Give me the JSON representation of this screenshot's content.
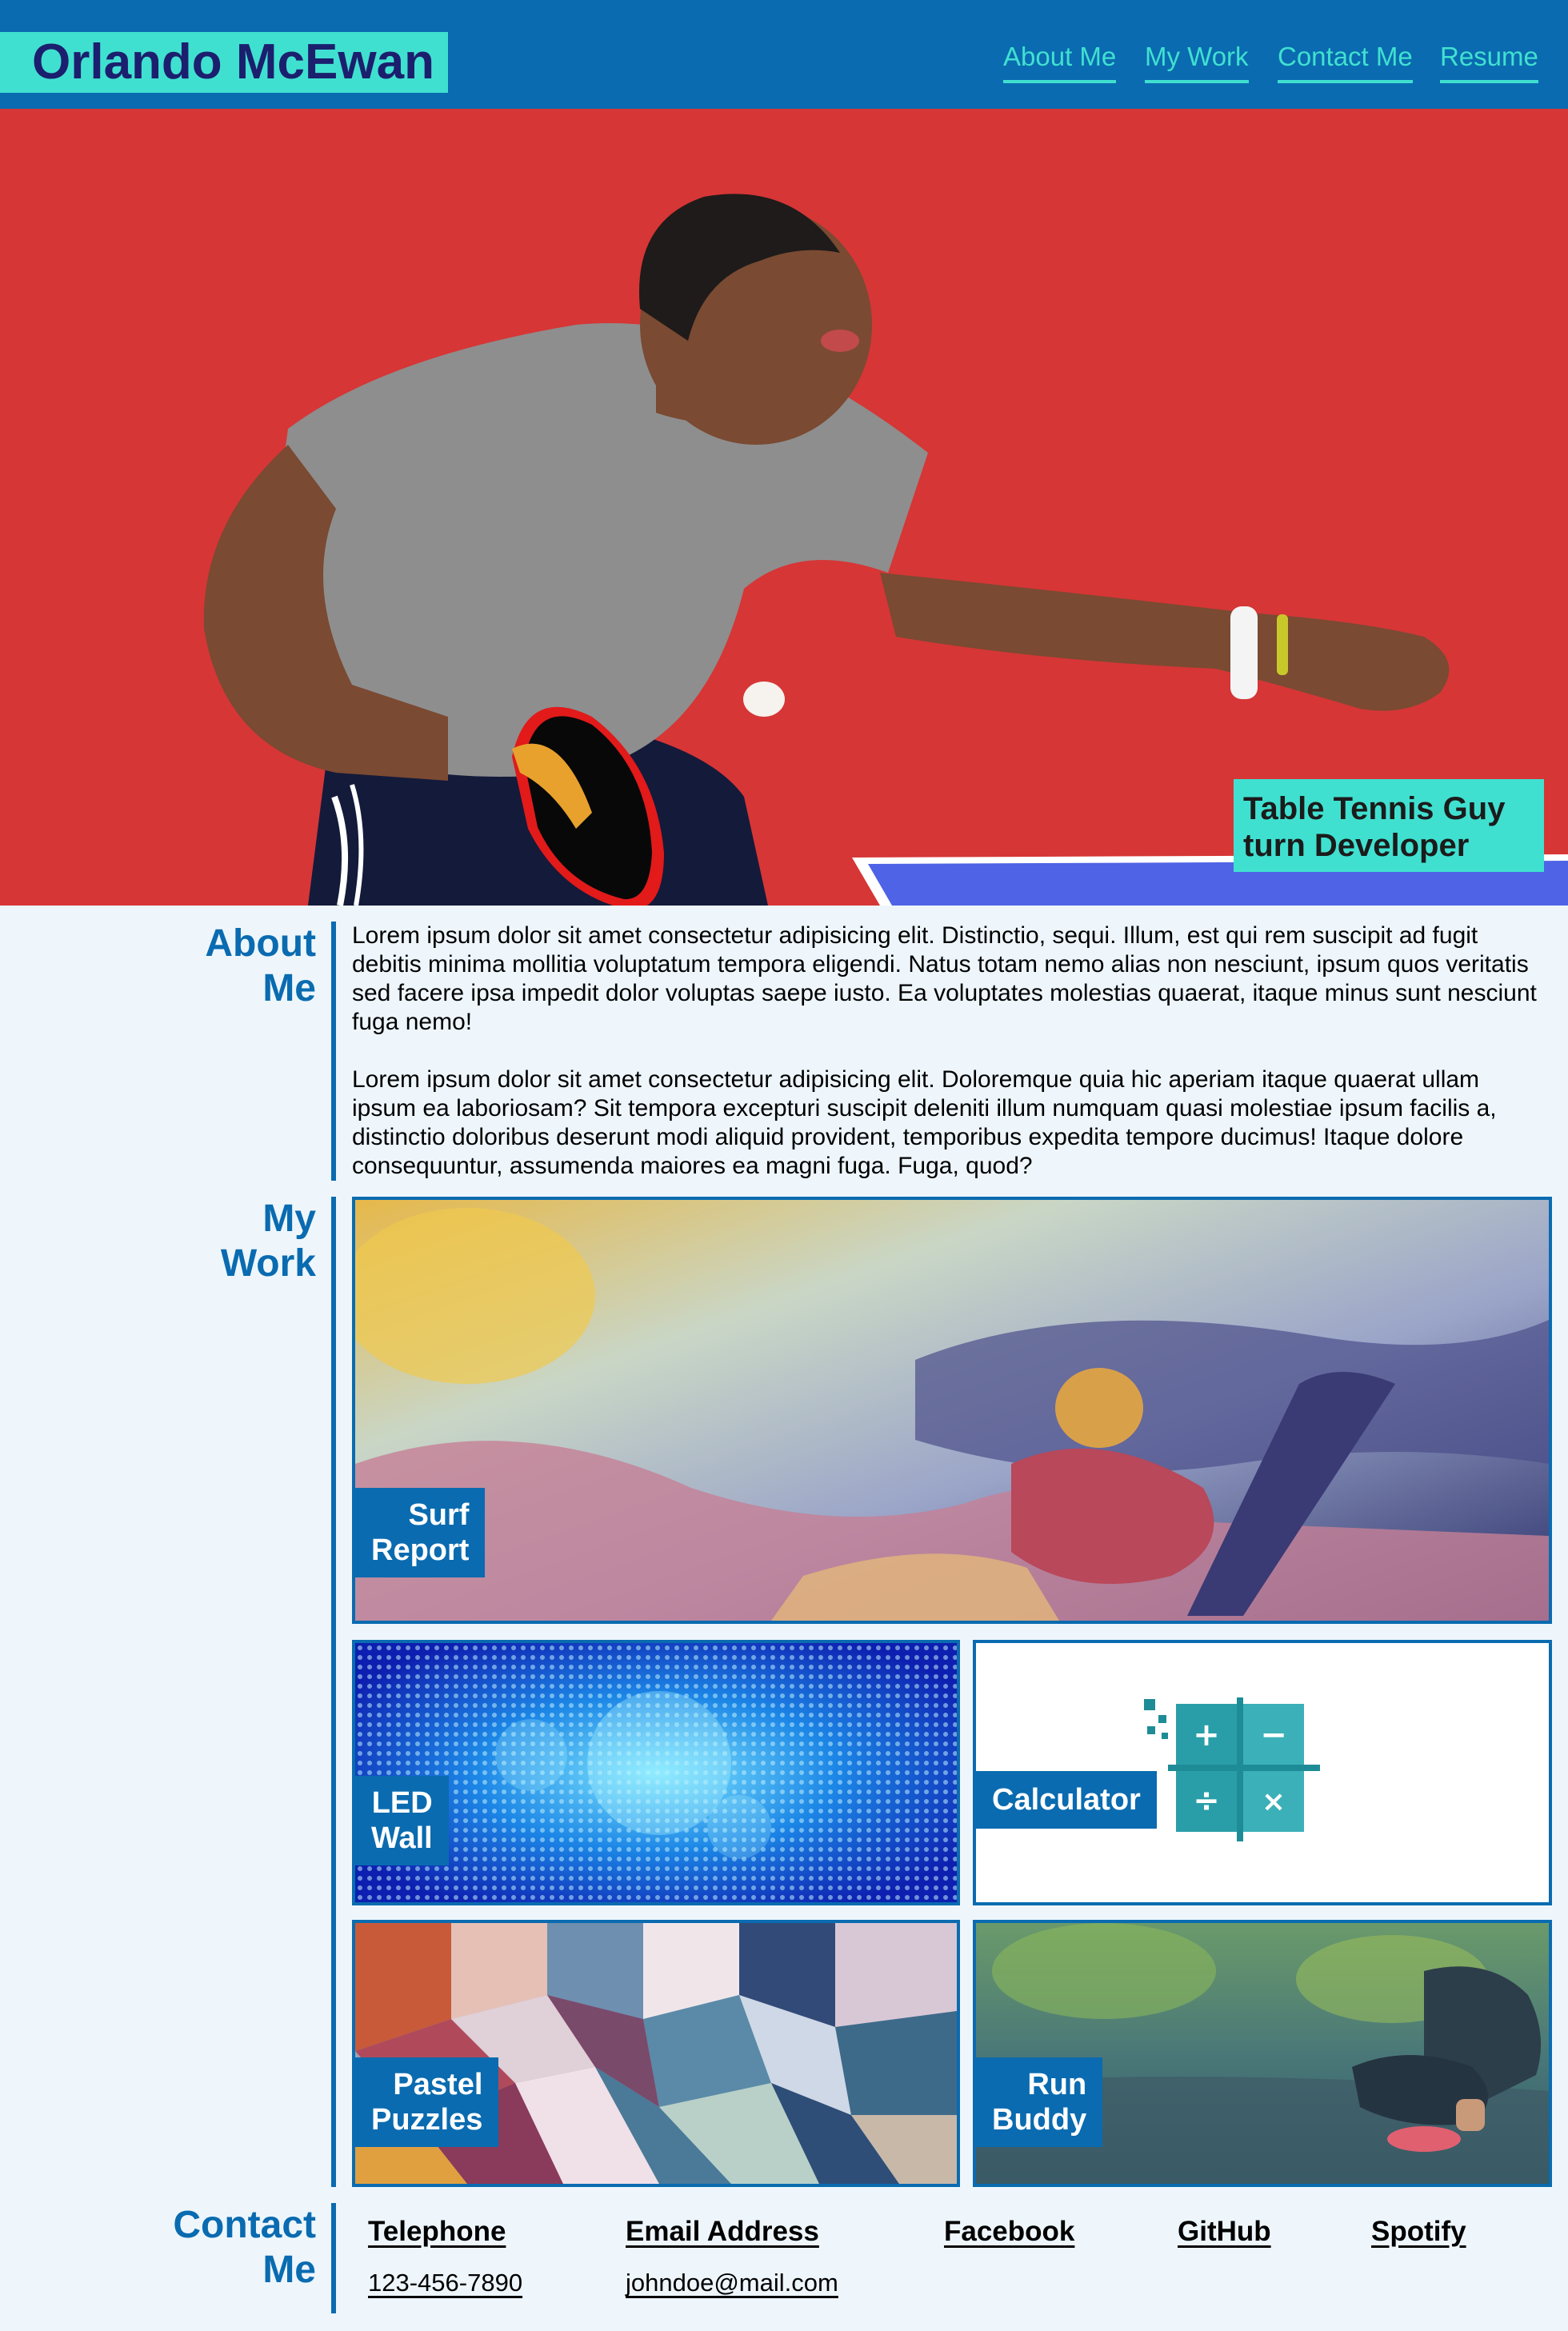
{
  "header": {
    "name": "Orlando McEwan",
    "nav": [
      "About Me",
      "My Work",
      "Contact Me",
      "Resume"
    ]
  },
  "hero": {
    "caption_line1": "Table Tennis Guy",
    "caption_line2": "turn Developer"
  },
  "about": {
    "title_line1": "About",
    "title_line2": "Me",
    "paragraph1": "Lorem ipsum dolor sit amet consectetur adipisicing elit. Distinctio, sequi. Illum, est qui rem suscipit ad fugit debitis minima mollitia voluptatum tempora eligendi. Natus totam nemo alias non nesciunt, ipsum quos veritatis sed facere ipsa impedit dolor voluptas saepe iusto. Ea voluptates molestias quaerat, itaque minus sunt nesciunt fuga nemo!",
    "paragraph2": "Lorem ipsum dolor sit amet consectetur adipisicing elit. Doloremque quia hic aperiam itaque quaerat ullam ipsum ea laboriosam? Sit tempora excepturi suscipit deleniti illum numquam quasi molestiae ipsum facilis a, distinctio doloribus deserunt modi aliquid provident, temporibus expedita tempore ducimus! Itaque dolore consequuntur, assumenda maiores ea magni fuga. Fuga, quod?"
  },
  "work": {
    "title_line1": "My",
    "title_line2": "Work",
    "projects": [
      {
        "line1": "Surf",
        "line2": "Report"
      },
      {
        "line1": "LED",
        "line2": "Wall"
      },
      {
        "line1": "Calculator",
        "line2": ""
      },
      {
        "line1": "Pastel",
        "line2": "Puzzles"
      },
      {
        "line1": "Run",
        "line2": "Buddy"
      }
    ]
  },
  "contact": {
    "title_line1": "Contact",
    "title_line2": "Me",
    "items": [
      {
        "label": "Telephone",
        "value": "123-456-7890"
      },
      {
        "label": "Email Address",
        "value": "johndoe@mail.com"
      },
      {
        "label": "Facebook",
        "value": ""
      },
      {
        "label": "GitHub",
        "value": ""
      },
      {
        "label": "Spotify",
        "value": ""
      }
    ]
  },
  "colors": {
    "primary": "#0a6bb0",
    "accent": "#40e0d0",
    "hero_bg": "#d63636",
    "page_bg": "#eef6fc"
  }
}
